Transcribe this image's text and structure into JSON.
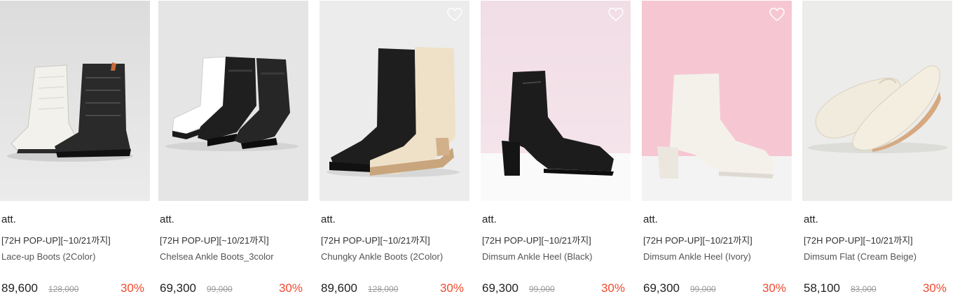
{
  "products": [
    {
      "brand": "att.",
      "promo": "[72H POP-UP][~10/21까지]",
      "name": "Lace-up Boots (2Color)",
      "price": "89,600",
      "original_price": "128,000",
      "discount": "30%",
      "image": "lace-up-boots-white-black",
      "wish_icon": "heart-outline-icon"
    },
    {
      "brand": "att.",
      "promo": "[72H POP-UP][~10/21까지]",
      "name": "Chelsea Ankle Boots_3color",
      "price": "69,300",
      "original_price": "99,000",
      "discount": "30%",
      "image": "chelsea-boots-white-black",
      "wish_icon": "heart-outline-icon"
    },
    {
      "brand": "att.",
      "promo": "[72H POP-UP][~10/21까지]",
      "name": "Chungky Ankle Boots (2Color)",
      "price": "89,600",
      "original_price": "128,000",
      "discount": "30%",
      "image": "chunky-boots-black-cream",
      "wish_icon": "heart-outline-icon"
    },
    {
      "brand": "att.",
      "promo": "[72H POP-UP][~10/21까지]",
      "name": "Dimsum Ankle Heel (Black)",
      "price": "69,300",
      "original_price": "99,000",
      "discount": "30%",
      "image": "ankle-heel-black-pink-bg",
      "wish_icon": "heart-outline-icon"
    },
    {
      "brand": "att.",
      "promo": "[72H POP-UP][~10/21까지]",
      "name": "Dimsum Ankle Heel (Ivory)",
      "price": "69,300",
      "original_price": "99,000",
      "discount": "30%",
      "image": "ankle-heel-ivory-pink-bg",
      "wish_icon": "heart-outline-icon"
    },
    {
      "brand": "att.",
      "promo": "[72H POP-UP][~10/21까지]",
      "name": "Dimsum Flat (Cream Beige)",
      "price": "58,100",
      "original_price": "83,000",
      "discount": "30%",
      "image": "flat-shoes-cream-beige",
      "wish_icon": "heart-outline-icon"
    }
  ],
  "colors": {
    "discount": "#f04a2f",
    "original_price": "#999999",
    "text": "#222222"
  }
}
